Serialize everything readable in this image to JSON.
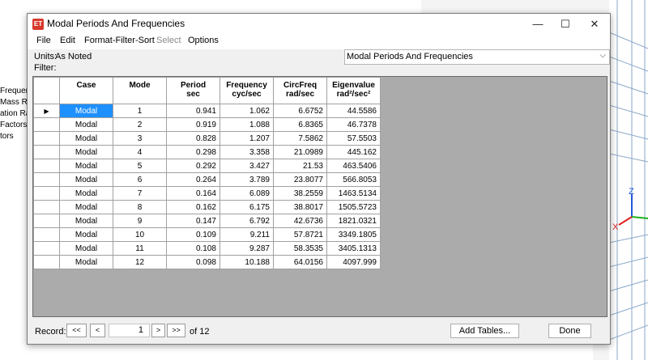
{
  "background": {
    "left_panel_items": [
      "Frequenci",
      "Mass Rati",
      "ation Rati",
      "Factors",
      "tors"
    ],
    "axis_labels": {
      "z": "Z",
      "x": "X"
    }
  },
  "dialog": {
    "app_icon_text": "ET",
    "title": "Modal Periods And Frequencies",
    "window_buttons": {
      "minimize": "—",
      "maximize": "☐",
      "close": "✕"
    }
  },
  "menu": {
    "items": [
      {
        "label": "File",
        "enabled": true
      },
      {
        "label": "Edit",
        "enabled": true
      },
      {
        "label": "Format-Filter-Sort",
        "enabled": true
      },
      {
        "label": "Select",
        "enabled": false
      },
      {
        "label": "Options",
        "enabled": true
      }
    ]
  },
  "units": {
    "label": "Units:",
    "value": "As Noted"
  },
  "filter": {
    "label": "Filter:"
  },
  "table_select": {
    "value": "Modal Periods And Frequencies",
    "arrow": "⌵"
  },
  "grid": {
    "columns": [
      {
        "line1": "Case",
        "line2": ""
      },
      {
        "line1": "Mode",
        "line2": ""
      },
      {
        "line1": "Period",
        "line2": "sec"
      },
      {
        "line1": "Frequency",
        "line2": "cyc/sec"
      },
      {
        "line1": "CircFreq",
        "line2": "rad/sec"
      },
      {
        "line1": "Eigenvalue",
        "line2": "rad²/sec²"
      }
    ],
    "rows": [
      [
        "Modal",
        "1",
        "0.941",
        "1.062",
        "6.6752",
        "44.5586"
      ],
      [
        "Modal",
        "2",
        "0.919",
        "1.088",
        "6.8365",
        "46.7378"
      ],
      [
        "Modal",
        "3",
        "0.828",
        "1.207",
        "7.5862",
        "57.5503"
      ],
      [
        "Modal",
        "4",
        "0.298",
        "3.358",
        "21.0989",
        "445.162"
      ],
      [
        "Modal",
        "5",
        "0.292",
        "3.427",
        "21.53",
        "463.5406"
      ],
      [
        "Modal",
        "6",
        "0.264",
        "3.789",
        "23.8077",
        "566.8053"
      ],
      [
        "Modal",
        "7",
        "0.164",
        "6.089",
        "38.2559",
        "1463.5134"
      ],
      [
        "Modal",
        "8",
        "0.162",
        "6.175",
        "38.8017",
        "1505.5723"
      ],
      [
        "Modal",
        "9",
        "0.147",
        "6.792",
        "42.6736",
        "1821.0321"
      ],
      [
        "Modal",
        "10",
        "0.109",
        "9.211",
        "57.8721",
        "3349.1805"
      ],
      [
        "Modal",
        "11",
        "0.108",
        "9.287",
        "58.3535",
        "3405.1313"
      ],
      [
        "Modal",
        "12",
        "0.098",
        "10.188",
        "64.0156",
        "4097.999"
      ]
    ],
    "selected_row": 0,
    "row_pointer": "▶"
  },
  "footer": {
    "record_label": "Record:",
    "first": "<<",
    "prev": "<",
    "current": "1",
    "next": ">",
    "last": ">>",
    "of_text": "of 12",
    "add_tables": "Add Tables...",
    "done": "Done"
  },
  "colors": {
    "selection": "#1e90ff",
    "grid_background": "#ababab",
    "app_icon": "#d63a2c",
    "axis_z": "#1e5bd8",
    "axis_x": "#e02020",
    "axis_y": "#20b020"
  }
}
